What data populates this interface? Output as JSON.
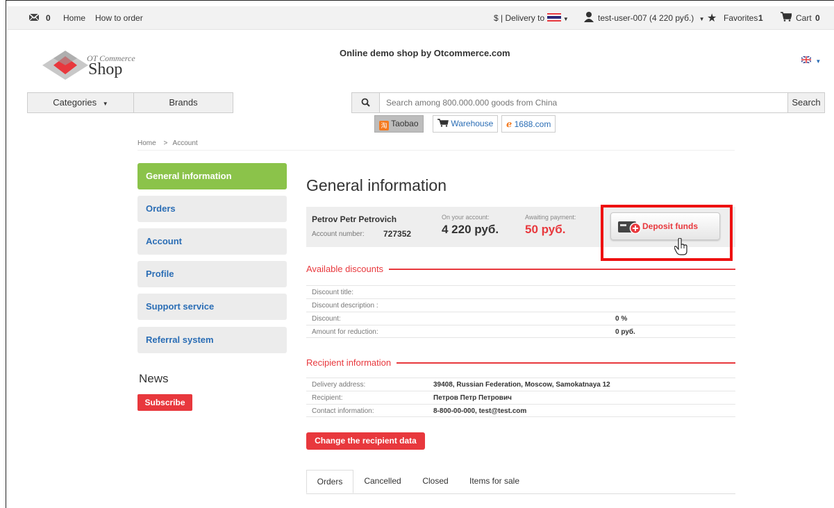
{
  "topbar": {
    "messages_count": "0",
    "home": "Home",
    "how_to_order": "How to order",
    "delivery": "$ | Delivery to",
    "user": "test-user-007 (4 220 руб.)",
    "favorites": "Favorites",
    "favorites_count": "1",
    "cart": "Cart",
    "cart_count": "0"
  },
  "header": {
    "logo_line1": "OT Commerce",
    "logo_line2": "Shop",
    "slogan": "Online demo shop by Otcommerce.com"
  },
  "nav": {
    "categories": "Categories",
    "brands": "Brands"
  },
  "search": {
    "placeholder": "Search among 800.000.000 goods from China",
    "button": "Search"
  },
  "sources": [
    {
      "label": "Taobao"
    },
    {
      "label": "Warehouse"
    },
    {
      "label": "1688.com"
    }
  ],
  "breadcrumb": {
    "home": "Home",
    "sep": ">",
    "current": "Account"
  },
  "sidebar": {
    "items": [
      {
        "label": "General information"
      },
      {
        "label": "Orders"
      },
      {
        "label": "Account"
      },
      {
        "label": "Profile"
      },
      {
        "label": "Support service"
      },
      {
        "label": "Referral system"
      }
    ],
    "news": "News",
    "subscribe": "Subscribe"
  },
  "main": {
    "title": "General information",
    "account": {
      "name": "Petrov Petr Petrovich",
      "number_label": "Account number:",
      "number": "727352",
      "balance_label": "On your account:",
      "balance": "4 220 руб.",
      "awaiting_label": "Awaiting payment:",
      "awaiting": "50 руб.",
      "deposit": "Deposit funds"
    },
    "discounts": {
      "title": "Available discounts",
      "rows": [
        {
          "label": "Discount title:",
          "value": ""
        },
        {
          "label": "Discount description :",
          "value": ""
        },
        {
          "label": "Discount:",
          "value": "0 %"
        },
        {
          "label": "Amount for reduction:",
          "value": "0 руб."
        }
      ]
    },
    "recipient": {
      "title": "Recipient information",
      "rows": [
        {
          "label": "Delivery address:",
          "value": "39408, Russian Federation, Moscow, Samokatnaya 12"
        },
        {
          "label": "Recipient:",
          "value": "Петров Петр Петрович"
        },
        {
          "label": "Contact information:",
          "value": "8-800-00-000, test@test.com"
        }
      ],
      "change_button": "Change the recipient data"
    },
    "tabs": [
      {
        "label": "Orders"
      },
      {
        "label": "Cancelled"
      },
      {
        "label": "Closed"
      },
      {
        "label": "Items for sale"
      }
    ]
  },
  "colors": {
    "accent_green": "#8bc34a",
    "accent_red": "#e8383d",
    "link_blue": "#2a6db5"
  }
}
